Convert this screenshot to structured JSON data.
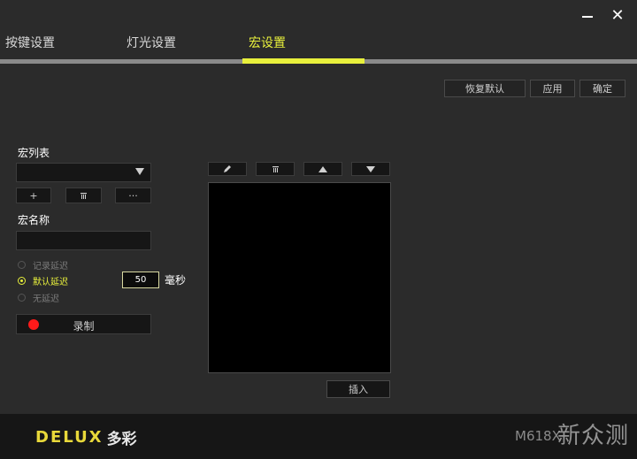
{
  "tabs": [
    {
      "label": "按键设置",
      "active": false
    },
    {
      "label": "灯光设置",
      "active": false
    },
    {
      "label": "宏设置",
      "active": true
    }
  ],
  "actions": {
    "restore_default": "恢复默认",
    "apply": "应用",
    "confirm": "确定"
  },
  "macro_list": {
    "label": "宏列表",
    "selected_value": "",
    "add_label": "+",
    "more_label": "···"
  },
  "macro_name": {
    "label": "宏名称",
    "value": ""
  },
  "delay_options": [
    {
      "label": "记录延迟",
      "selected": false
    },
    {
      "label": "默认延迟",
      "selected": true
    },
    {
      "label": "无延迟",
      "selected": false
    }
  ],
  "delay": {
    "value": "50",
    "unit": "毫秒"
  },
  "record": {
    "label": "录制"
  },
  "editor": {
    "insert_label": "插入",
    "steps": []
  },
  "footer": {
    "brand_en": "DELUX",
    "brand_cn": "多彩",
    "model": "M618X",
    "watermark": "新众测"
  },
  "colors": {
    "accent": "#e8f03c",
    "background": "#2b2b2b",
    "record": "#ff1a1a"
  },
  "icons": [
    "minimize-icon",
    "close-icon",
    "dropdown-arrow-icon",
    "delete-icon",
    "edit-icon",
    "move-up-icon",
    "move-down-icon",
    "record-dot-icon"
  ]
}
